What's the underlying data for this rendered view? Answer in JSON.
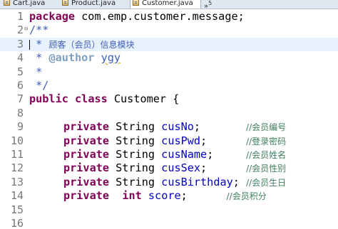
{
  "tabs": [
    {
      "label": "Cart.java",
      "active": false
    },
    {
      "label": "Product.java",
      "active": false
    },
    {
      "label": "Customer.java",
      "active": true,
      "close": "✕"
    }
  ],
  "tab_overflow": {
    "symbol": "»",
    "count": "5"
  },
  "line_numbers": [
    "1",
    "2",
    "3",
    "4",
    "5",
    "6",
    "7",
    "8",
    "9",
    "10",
    "11",
    "12",
    "13",
    "14",
    "15",
    "16"
  ],
  "code": {
    "l1": {
      "kw": "package",
      "rest": " com.emp.customer.message;"
    },
    "l2": {
      "text": "/**"
    },
    "l3": {
      "prefix": " * ",
      "text": "顾客（会员）信息模块"
    },
    "l4": {
      "prefix": " * ",
      "tag": "@author",
      "space": " ",
      "value": "ygy"
    },
    "l5": {
      "text": " *"
    },
    "l6": {
      "text": " */"
    },
    "l7": {
      "kw1": "public",
      "kw2": "class",
      "rest": " Customer {"
    },
    "fields": [
      {
        "kw": "private",
        "type": " String ",
        "name": "cusNo",
        "pad": ";       ",
        "comment": "//会员编号"
      },
      {
        "kw": "private",
        "type": " String ",
        "name": "cusPwd",
        "pad": ";      ",
        "comment": "//登录密码"
      },
      {
        "kw": "private",
        "type": " String ",
        "name": "cusName",
        "pad": ";     ",
        "comment": "//会员姓名"
      },
      {
        "kw": "private",
        "type": " String ",
        "name": "cusSex",
        "pad": ";      ",
        "comment": "//会员性别"
      },
      {
        "kw": "private",
        "type": " String ",
        "name": "cusBirthday",
        "pad": "; ",
        "comment": "//会员生日"
      }
    ],
    "l14": {
      "kw1": "private",
      "kw2": "int",
      "name": "score",
      "pad": ";      ",
      "comment": "//会员积分"
    }
  },
  "colors": {
    "keyword": "#7f0055",
    "field": "#0000c0",
    "javadoc": "#3f5fbf",
    "javadoc_tag": "#7f9fbf",
    "comment": "#3f7f5f",
    "current_line": "#e8f2fe",
    "line_number": "#787878"
  },
  "icons": {
    "file_tab": "java-file-icon",
    "fold": "fold-collapse-icon",
    "overflow": "chevron-double-right-icon"
  }
}
